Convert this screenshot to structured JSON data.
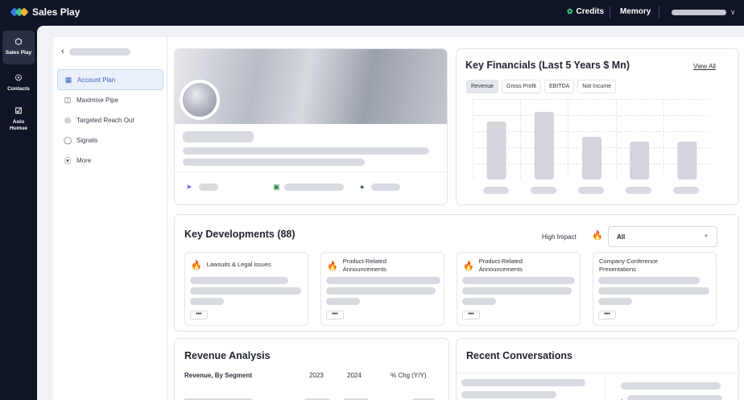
{
  "brand": {
    "name": "Sales Play"
  },
  "topbar": {
    "credits": "Credits",
    "memory": "Memory"
  },
  "rail": [
    {
      "label": "Sales Play"
    },
    {
      "label": "Contacts"
    },
    {
      "label": "Aoio Humue"
    }
  ],
  "nav": {
    "items": [
      {
        "label": "Account Plan",
        "icon": "grid-icon"
      },
      {
        "label": "Maximixe Pipe",
        "icon": "briefcase-icon"
      },
      {
        "label": "Targeted Reach Out",
        "icon": "target-icon"
      },
      {
        "label": "Signals",
        "icon": "globe-icon"
      },
      {
        "label": "More",
        "icon": "compass-icon"
      }
    ]
  },
  "financials": {
    "title": "Key Financials (Last 5 Years $ Mn)",
    "view_all": "View All",
    "tabs": [
      "Revenue",
      "Gross Profit",
      "EBITDA",
      "Not Incume"
    ],
    "active_tab": "Revenue"
  },
  "chart_data": {
    "type": "bar",
    "categories": [
      "",
      "",
      "",
      "",
      ""
    ],
    "values": [
      72,
      84,
      53,
      47,
      47
    ],
    "ylim": [
      0,
      100
    ],
    "grid": true,
    "bar_color": "#d3d5dc"
  },
  "developments": {
    "title": "Key Developments (88)",
    "filter_label": "High Impact",
    "select_value": "All",
    "cards": [
      {
        "title": "Lawsuits & Legal issues",
        "flame": true
      },
      {
        "title": "Product-Related Announcements",
        "flame": true
      },
      {
        "title": "Product-Related Announcements",
        "flame": true
      },
      {
        "title": "Company Conference Presentations",
        "flame": false
      }
    ],
    "more": "•••"
  },
  "revenue": {
    "title": "Revenue Analysis",
    "subtitle": "Revenue, By Segment",
    "col_2023": "2023",
    "col_2024": "2024",
    "col_chg": "% Chg (Y/Y)"
  },
  "conversations": {
    "title": "Recent Conversations"
  },
  "colors": {
    "accent": "#3a62b5",
    "flame": "#f07a1a",
    "dark": "#0f1426"
  }
}
